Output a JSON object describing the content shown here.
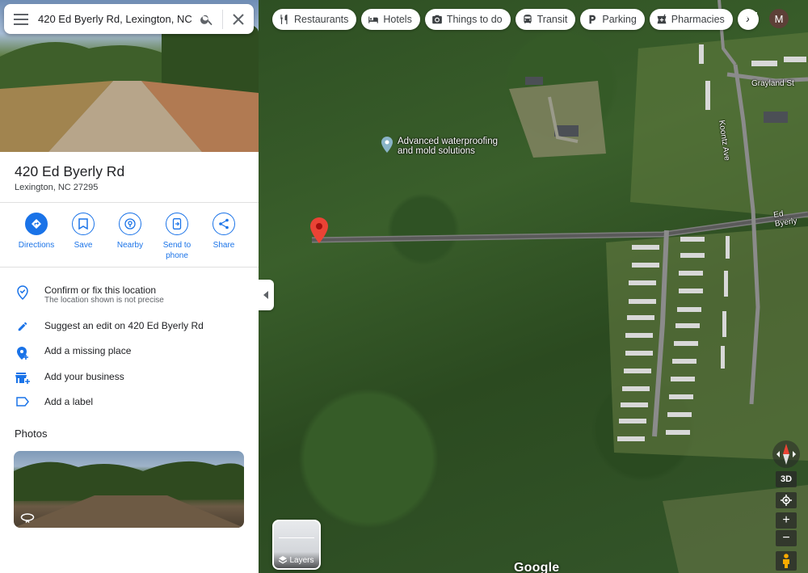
{
  "search": {
    "value": "420 Ed Byerly Rd, Lexington, NC"
  },
  "place": {
    "title": "420 Ed Byerly Rd",
    "address": "Lexington, NC 27295"
  },
  "actions": [
    {
      "label": "Directions",
      "icon": "directions-icon"
    },
    {
      "label": "Save",
      "icon": "bookmark-icon"
    },
    {
      "label": "Nearby",
      "icon": "nearby-icon"
    },
    {
      "label": "Send to phone",
      "icon": "send-to-phone-icon"
    },
    {
      "label": "Share",
      "icon": "share-icon"
    }
  ],
  "list": {
    "confirm": {
      "label": "Confirm or fix this location",
      "sub": "The location shown is not precise"
    },
    "suggest_edit": {
      "label": "Suggest an edit on 420 Ed Byerly Rd"
    },
    "add_place": {
      "label": "Add a missing place"
    },
    "add_business": {
      "label": "Add your business"
    },
    "add_label": {
      "label": "Add a label"
    }
  },
  "photos": {
    "title": "Photos"
  },
  "chips": [
    "Restaurants",
    "Hotels",
    "Things to do",
    "Transit",
    "Parking",
    "Pharmacies"
  ],
  "user": {
    "initial": "M"
  },
  "map": {
    "poi": "Advanced waterproofing and mold solutions",
    "roads": {
      "grayland": "Grayland St",
      "koontz": "Koontz Ave",
      "byerly": "Ed Byerly"
    },
    "layers_label": "Layers",
    "controls": {
      "three_d": "3D",
      "zoom_in": "+",
      "zoom_out": "−"
    },
    "logo": "Google"
  },
  "colors": {
    "accent": "#1a73e8",
    "pin": "#ea4335"
  }
}
